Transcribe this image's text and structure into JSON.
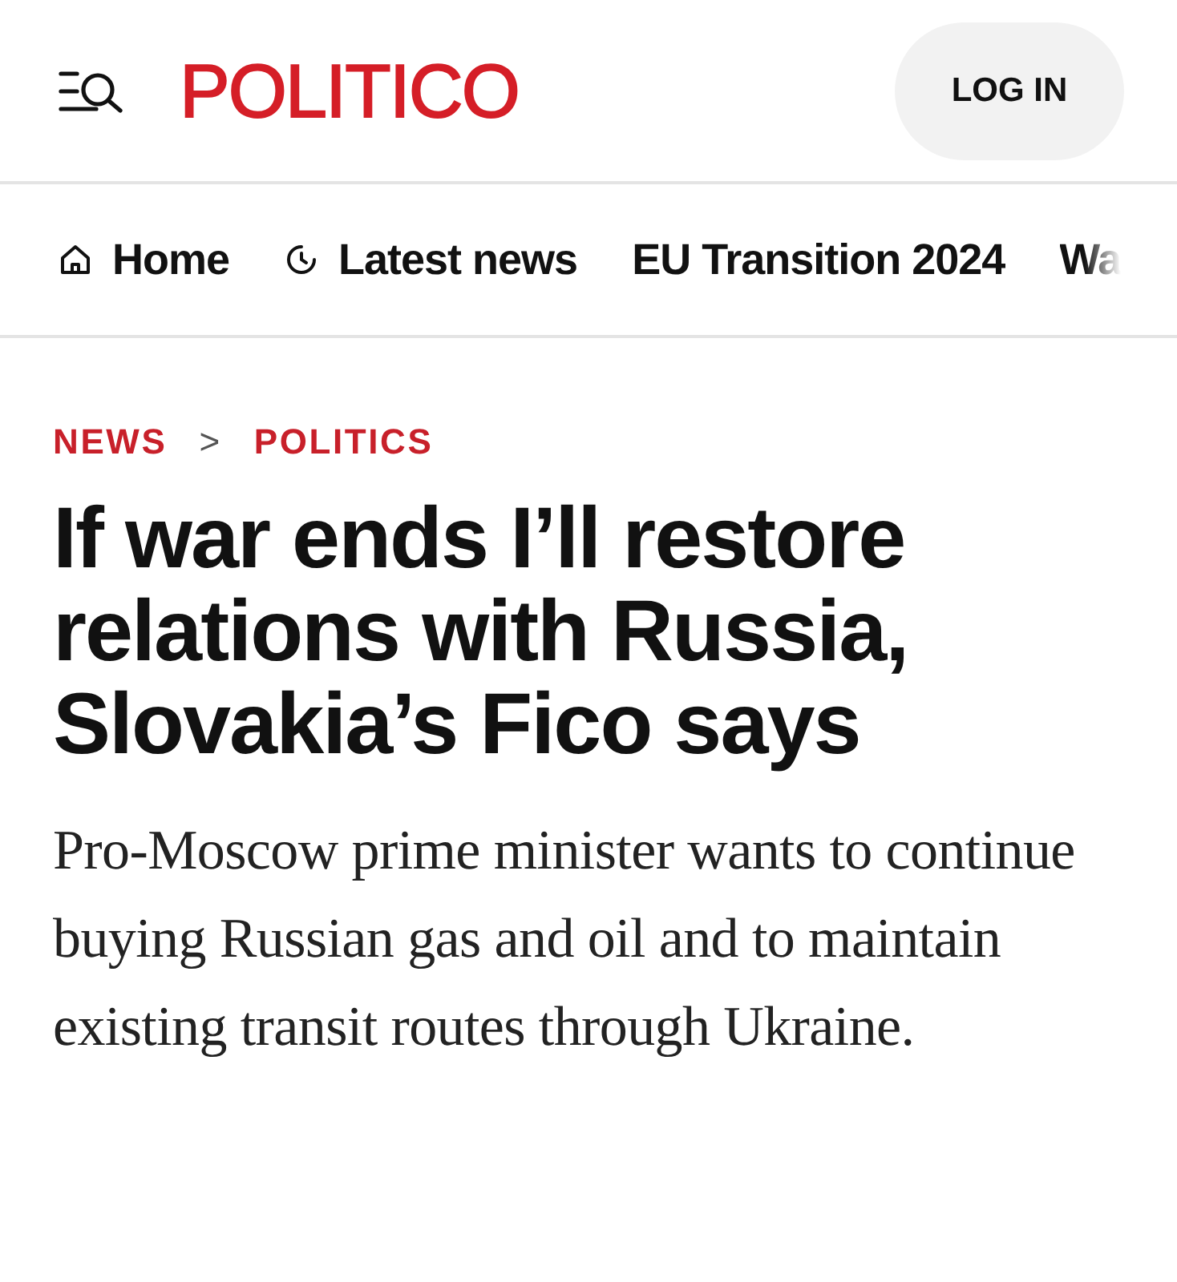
{
  "header": {
    "logo": "POLITICO",
    "login": "LOG IN"
  },
  "nav": [
    {
      "label": "Home",
      "kind": "home"
    },
    {
      "label": "Latest news",
      "kind": "clock"
    },
    {
      "label": "EU Transition 2024",
      "kind": "plain"
    },
    {
      "label": "Wa",
      "kind": "plain"
    }
  ],
  "breadcrumb": {
    "items": [
      "NEWS",
      "POLITICS"
    ],
    "separator": ">"
  },
  "headline": "If war ends I’ll restore relations with Russia, Slovakia’s Fico says",
  "dek": "Pro-Moscow prime minister wants to continue buying Russian gas and oil and to maintain existing transit routes through Ukraine."
}
